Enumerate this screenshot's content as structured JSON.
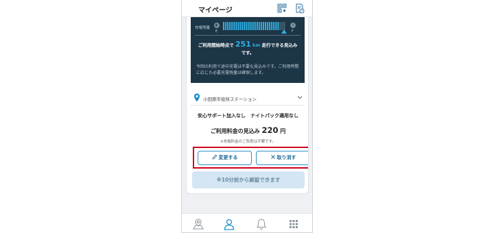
{
  "header": {
    "title": "マイページ",
    "icons": [
      "qr-code-icon",
      "document-clock-icon"
    ]
  },
  "battery": {
    "label": "充電残量",
    "empty_label": "E",
    "full_label": "F",
    "level": 0.9
  },
  "range": {
    "prefix": "ご利用開始時点で",
    "value": "251",
    "unit": "km",
    "suffix": "走行できる見込み",
    "line2": "です。"
  },
  "note": "今回の利用で途中充電は不要な見込みです。ご利用時間に応じた必要充電残量は確保します。",
  "station": {
    "name": "小田原市役所ステーション"
  },
  "reservation": {
    "options": "安心サポート加入なし　ナイトパック適用なし",
    "fee_label": "ご利用料金の見込み",
    "fee_value": "220",
    "fee_unit": "円",
    "fee_note": "※充電料金のご負担は不要です。"
  },
  "buttons": {
    "change": "変更する",
    "cancel": "取り消す",
    "unlock": "※10分前から解錠できます"
  },
  "tabbar": {
    "icons": [
      "map-pin-icon",
      "user-icon",
      "bell-icon",
      "grid-menu-icon"
    ]
  },
  "colors": {
    "accent": "#2fb0e4",
    "dark_panel": "#1c3547",
    "button_border": "#2f8fc4",
    "highlight": "#d0021b"
  }
}
